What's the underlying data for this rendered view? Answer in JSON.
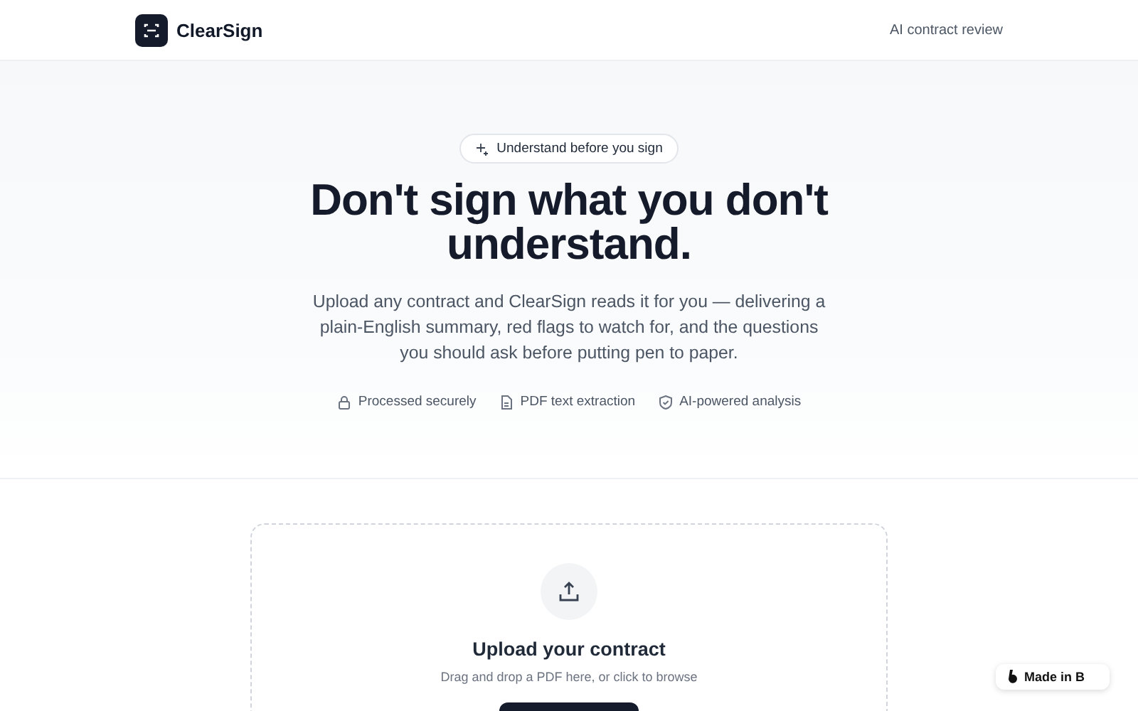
{
  "header": {
    "brand": "ClearSign",
    "nav_link": "AI contract review"
  },
  "hero": {
    "badge": "Understand before you sign",
    "title_lines": [
      "Don't sign what you don't",
      "understand."
    ],
    "description": "Upload any contract and ClearSign reads it for you — delivering a plain-English summary, red flags to watch for, and the questions you should ask before putting pen to paper.",
    "features": [
      {
        "kind": "lock",
        "label": "Processed securely"
      },
      {
        "kind": "file",
        "label": "PDF text extraction"
      },
      {
        "kind": "shield",
        "label": "AI-powered analysis"
      }
    ]
  },
  "upload": {
    "title": "Upload your contract",
    "hint": "Drag and drop a PDF here, or click to browse"
  },
  "made_badge": {
    "label": "Made in B"
  }
}
